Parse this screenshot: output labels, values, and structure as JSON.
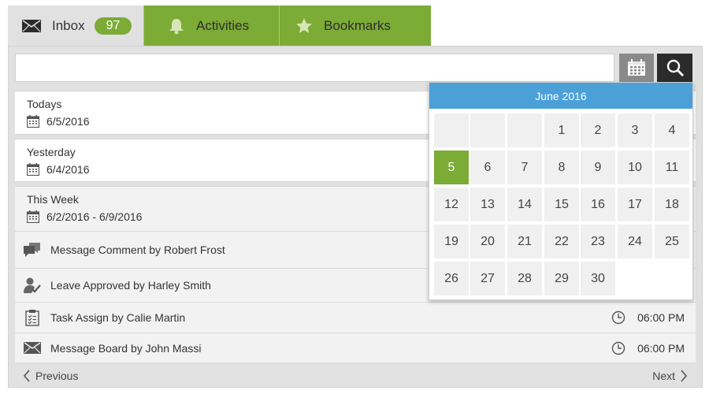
{
  "tabs": {
    "inbox": {
      "label": "Inbox",
      "count": "97"
    },
    "activities": {
      "label": "Activities"
    },
    "bookmarks": {
      "label": "Bookmarks"
    }
  },
  "search": {
    "value": "",
    "placeholder": ""
  },
  "groups": {
    "today": {
      "label": "Todays",
      "date": "6/5/2016"
    },
    "yesterday": {
      "label": "Yesterday",
      "date": "6/4/2016"
    },
    "week": {
      "label": "This Week",
      "date": "6/2/2016 - 6/9/2016"
    }
  },
  "items": [
    {
      "icon": "comment-icon",
      "text": "Message Comment by Robert Frost",
      "time": ""
    },
    {
      "icon": "user-check-icon",
      "text": "Leave Approved by Harley Smith",
      "time": ""
    },
    {
      "icon": "clipboard-icon",
      "text": "Task Assign by Calie Martin",
      "time": "06:00 PM"
    },
    {
      "icon": "envelope-icon",
      "text": "Message Board by John Massi",
      "time": "06:00 PM"
    }
  ],
  "pager": {
    "previous": "Previous",
    "next": "Next"
  },
  "calendar": {
    "title": "June 2016",
    "selected": "5",
    "days": [
      [
        "",
        "",
        "",
        "1",
        "2",
        "3",
        "4"
      ],
      [
        "5",
        "6",
        "7",
        "8",
        "9",
        "10",
        "11"
      ],
      [
        "12",
        "13",
        "14",
        "15",
        "16",
        "17",
        "18"
      ],
      [
        "19",
        "20",
        "21",
        "22",
        "23",
        "24",
        "25"
      ],
      [
        "26",
        "27",
        "28",
        "29",
        "30"
      ]
    ]
  },
  "colors": {
    "accent_green": "#7cab36",
    "calendar_header": "#4ba0d8",
    "search_button": "#2b2b2b"
  }
}
